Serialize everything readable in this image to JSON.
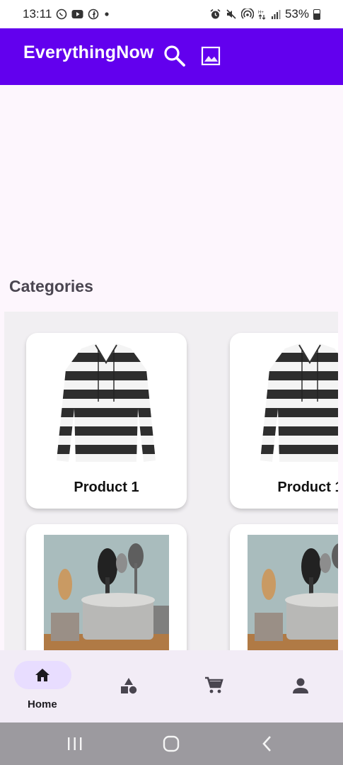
{
  "status_bar": {
    "time": "13:11",
    "battery": "53%",
    "left_icons": [
      "whatsapp-icon",
      "youtube-icon",
      "facebook-icon",
      "dot-icon"
    ],
    "right_icons": [
      "alarm-icon",
      "mute-icon",
      "hotspot-icon",
      "data-icon",
      "signal-icon",
      "battery-icon"
    ]
  },
  "app_bar": {
    "title": "EverythingNow",
    "background": "#6200ee",
    "actions": [
      "search-icon",
      "image-icon"
    ]
  },
  "categories": {
    "title": "Categories",
    "items": [
      {
        "label": "Product 1",
        "image": "striped-shirt"
      },
      {
        "label": "Product 1",
        "image": "striped-shirt"
      },
      {
        "label": "",
        "image": "kitchen-utensils"
      },
      {
        "label": "",
        "image": "kitchen-utensils"
      }
    ]
  },
  "bottom_nav": {
    "items": [
      {
        "label": "Home",
        "icon": "home-icon",
        "selected": true
      },
      {
        "label": "",
        "icon": "categories-icon",
        "selected": false
      },
      {
        "label": "",
        "icon": "cart-icon",
        "selected": false
      },
      {
        "label": "",
        "icon": "profile-icon",
        "selected": false
      }
    ],
    "selected_color": "#e8ddff"
  },
  "system_nav": [
    "recents-button",
    "home-button",
    "back-button"
  ]
}
